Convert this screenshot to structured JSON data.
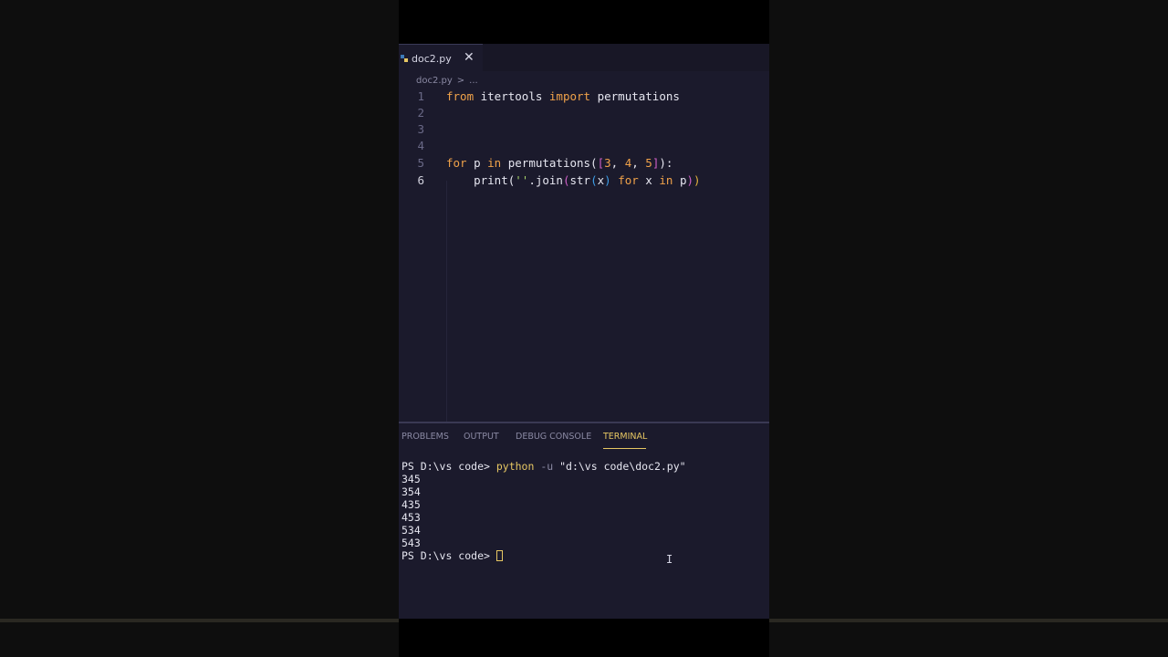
{
  "editor": {
    "tab_label": "doc2.py",
    "tab_close": "✕",
    "breadcrumb": [
      "doc2.py",
      ">",
      "..."
    ]
  },
  "code": {
    "line_numbers": [
      "1",
      "2",
      "3",
      "4",
      "5",
      "6"
    ],
    "line1": {
      "kw1": "from",
      "mod": " itertools ",
      "kw2": "import",
      "name": " permutations"
    },
    "line5": {
      "kw1": "for",
      "v": " p ",
      "kw2": "in",
      "call": " permutations(",
      "b1": "[",
      "n1": "3",
      "c1": ", ",
      "n2": "4",
      "c2": ", ",
      "n3": "5",
      "b2": "]",
      "end": "):"
    },
    "line6": {
      "pre": "    print(",
      "s": "''",
      "join": ".join",
      "p1": "(",
      "str": "str",
      "p2": "(",
      "x": "x",
      "p3": ")",
      "kw1": " for",
      "mid": " x ",
      "kw2": "in",
      "tail": " p",
      "p4": ")",
      "p5": ")"
    }
  },
  "panel": {
    "tabs": [
      "PROBLEMS",
      "OUTPUT",
      "DEBUG CONSOLE",
      "TERMINAL"
    ],
    "active_tab": "TERMINAL"
  },
  "terminal": {
    "prompt": "PS D:\\vs code> ",
    "cmd": "python",
    "flag": " -u ",
    "arg": "\"d:\\vs code\\doc2.py\"",
    "output": [
      "345",
      "354",
      "435",
      "453",
      "534",
      "543"
    ],
    "final_prompt": "PS D:\\vs code> "
  },
  "colors": {
    "keyword": "#f0a24a",
    "accent": "#e7c763",
    "editor_bg": "#1b1a2c"
  },
  "icons": {
    "tab_icon": "python-file-icon",
    "close": "close-icon",
    "cursor": "text-cursor-icon"
  }
}
